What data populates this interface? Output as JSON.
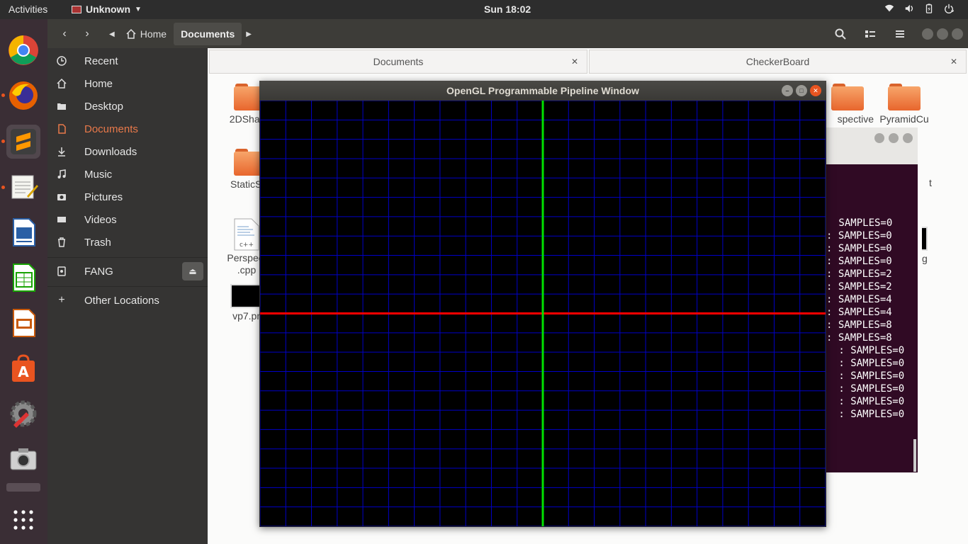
{
  "topbar": {
    "activities": "Activities",
    "app_name": "Unknown",
    "clock": "Sun 18:02",
    "tray_icons": [
      "wifi-icon",
      "volume-icon",
      "battery-icon",
      "power-menu-icon"
    ]
  },
  "dock": {
    "items": [
      {
        "name": "chrome",
        "icon": "chrome-icon",
        "running": false
      },
      {
        "name": "firefox",
        "icon": "firefox-icon",
        "running": true
      },
      {
        "name": "sublime-text",
        "icon": "sublime-icon",
        "running": true
      },
      {
        "name": "text-editor",
        "icon": "text-editor-icon",
        "running": true
      },
      {
        "name": "libreoffice-writer",
        "icon": "writer-icon",
        "running": false
      },
      {
        "name": "libreoffice-calc",
        "icon": "calc-icon",
        "running": false
      },
      {
        "name": "libreoffice-impress",
        "icon": "impress-icon",
        "running": false
      },
      {
        "name": "software-center",
        "icon": "software-icon",
        "running": false
      },
      {
        "name": "system-settings",
        "icon": "settings-icon",
        "running": false
      },
      {
        "name": "camera",
        "icon": "camera-icon",
        "running": false
      },
      {
        "name": "opengl-window",
        "icon": "window-icon",
        "running": true
      },
      {
        "name": "show-applications",
        "icon": "app-grid-icon",
        "running": false
      }
    ]
  },
  "files": {
    "pathbar": {
      "home": "Home",
      "current": "Documents"
    },
    "sidebar": [
      {
        "label": "Recent",
        "icon": "clock-icon"
      },
      {
        "label": "Home",
        "icon": "home-icon"
      },
      {
        "label": "Desktop",
        "icon": "desktop-folder-icon"
      },
      {
        "label": "Documents",
        "icon": "document-icon",
        "active": true
      },
      {
        "label": "Downloads",
        "icon": "download-icon"
      },
      {
        "label": "Music",
        "icon": "music-icon"
      },
      {
        "label": "Pictures",
        "icon": "camera-icon"
      },
      {
        "label": "Videos",
        "icon": "video-icon"
      },
      {
        "label": "Trash",
        "icon": "trash-icon"
      },
      {
        "label": "FANG",
        "icon": "drive-icon"
      },
      {
        "label": "Other Locations",
        "icon": "plus-icon"
      }
    ],
    "tabs": [
      {
        "label": "Documents"
      },
      {
        "label": "CheckerBoard"
      }
    ],
    "items": [
      {
        "label": "2DShape",
        "type": "folder"
      },
      {
        "label": "StaticSm",
        "type": "folder"
      },
      {
        "label": "Perspect",
        "label2": ".cpp",
        "type": "cpp"
      },
      {
        "label": "vp7.png",
        "type": "image"
      },
      {
        "label": "spective",
        "type": "folder"
      },
      {
        "label": "PyramidCu",
        "type": "folder"
      },
      {
        "label": "t",
        "type": "text"
      },
      {
        "label": "g",
        "type": "image"
      }
    ]
  },
  "terminal": {
    "lines": [
      " SAMPLES=0",
      ": SAMPLES=0",
      ": SAMPLES=0",
      ": SAMPLES=0",
      ": SAMPLES=2",
      ": SAMPLES=2",
      ": SAMPLES=4",
      ": SAMPLES=4",
      ": SAMPLES=8",
      ": SAMPLES=8",
      " : SAMPLES=0",
      " : SAMPLES=0",
      " : SAMPLES=0",
      " : SAMPLES=0",
      " : SAMPLES=0",
      " : SAMPLES=0"
    ]
  },
  "opengl": {
    "title": "OpenGL Programmable Pipeline Window",
    "grid_color": "#0000c8",
    "x_axis_color": "#ff0000",
    "y_axis_color": "#00e000",
    "grid_divisions": 22,
    "background": "#000000"
  }
}
